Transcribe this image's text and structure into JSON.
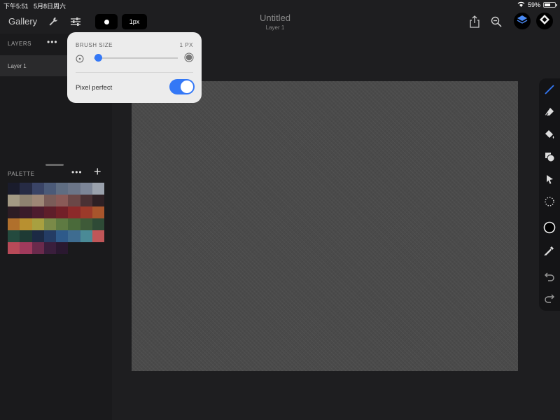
{
  "status_bar": {
    "time": "下午5:51",
    "date": "5月8日周六",
    "battery": "59%",
    "battery_level": 0.59
  },
  "toolbar_top": {
    "gallery_label": "Gallery",
    "brush_shape": "dot",
    "brush_size_label": "1px",
    "doc_title": "Untitled",
    "doc_subtitle": "Layer 1",
    "icons": [
      "wrench-icon",
      "sliders-icon",
      "share-icon",
      "zoom-out-icon",
      "layers-icon",
      "eraser-mode-icon"
    ]
  },
  "layers_panel": {
    "title": "LAYERS",
    "layers": [
      {
        "name": "Layer 1"
      }
    ]
  },
  "palette_panel": {
    "title": "PALETTE",
    "colors": [
      "#1a1c2c",
      "#262b44",
      "#3a4466",
      "#4b5a78",
      "#5f6d82",
      "#6b7588",
      "#7c8597",
      "#9aa1ac",
      "#a39a84",
      "#8e8270",
      "#9e8776",
      "#7a5c58",
      "#8a5a57",
      "#6b4747",
      "#4a3134",
      "#2e2024",
      "#2c1c24",
      "#3a1c2a",
      "#4d1c2e",
      "#5e1e2a",
      "#722028",
      "#8c2a2a",
      "#9c3a2a",
      "#a8552c",
      "#b0702c",
      "#b89030",
      "#a8a040",
      "#7a8a48",
      "#5e7a42",
      "#4a6a3a",
      "#3e5a38",
      "#2e4a36",
      "#244a3e",
      "#1e3a34",
      "#1c2a44",
      "#243c64",
      "#2e5a8a",
      "#3e6c90",
      "#4a8a96",
      "#c05658",
      "#b84a58",
      "#a03a5c",
      "#6a2a4c",
      "#3a1e3c",
      "#2a1830"
    ]
  },
  "brush_popover": {
    "size_label": "BRUSH SIZE",
    "size_value": "1 PX",
    "slider_fraction": 0.05,
    "pixel_perfect_label": "Pixel perfect",
    "pixel_perfect_on": true
  },
  "tools": [
    "pencil-icon",
    "eraser-icon",
    "fill-bucket-icon",
    "shape-icon",
    "move-icon",
    "lasso-icon",
    "color-icon",
    "eyedropper-icon",
    "undo-icon",
    "redo-icon"
  ],
  "colors": {
    "accent": "#3478f6",
    "canvas": "#4a4a4a",
    "background": "#1e1e20",
    "panel": "#1a1a1c"
  }
}
